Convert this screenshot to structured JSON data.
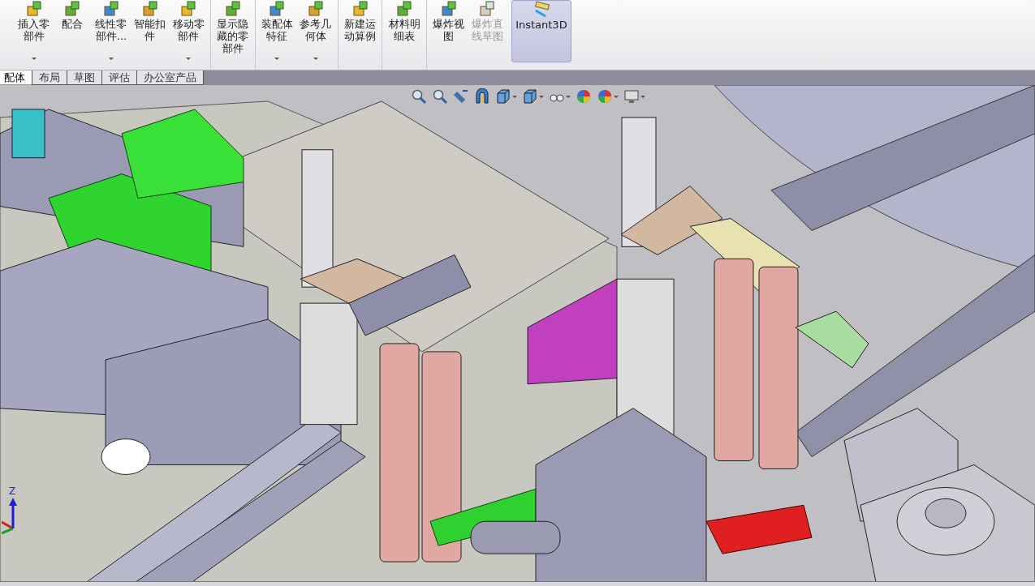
{
  "toolbar": {
    "items": [
      {
        "label": "插入零部件",
        "kind": "command",
        "dropdown": true,
        "disabled": false,
        "active": false,
        "group_start": false
      },
      {
        "label": "配合",
        "kind": "command",
        "dropdown": false,
        "disabled": false,
        "active": false,
        "group_start": false
      },
      {
        "label": "线性零部件...",
        "kind": "command",
        "dropdown": true,
        "disabled": false,
        "active": false,
        "group_start": false
      },
      {
        "label": "智能扣件",
        "kind": "command",
        "dropdown": false,
        "disabled": false,
        "active": false,
        "group_start": false
      },
      {
        "label": "移动零部件",
        "kind": "command",
        "dropdown": true,
        "disabled": false,
        "active": false,
        "group_start": false
      },
      {
        "label": "显示隐藏的零部件",
        "kind": "command",
        "dropdown": false,
        "disabled": false,
        "active": false,
        "group_start": true
      },
      {
        "label": "装配体特征",
        "kind": "command",
        "dropdown": true,
        "disabled": false,
        "active": false,
        "group_start": true
      },
      {
        "label": "参考几何体",
        "kind": "command",
        "dropdown": true,
        "disabled": false,
        "active": false,
        "group_start": false
      },
      {
        "label": "新建运动算例",
        "kind": "command",
        "dropdown": false,
        "disabled": false,
        "active": false,
        "group_start": true
      },
      {
        "label": "材料明细表",
        "kind": "command",
        "dropdown": false,
        "disabled": false,
        "active": false,
        "group_start": true
      },
      {
        "label": "爆炸视图",
        "kind": "command",
        "dropdown": false,
        "disabled": false,
        "active": false,
        "group_start": true
      },
      {
        "label": "爆炸直线草图",
        "kind": "command",
        "dropdown": false,
        "disabled": true,
        "active": false,
        "group_start": false
      },
      {
        "label": "Instant3D",
        "kind": "toggle",
        "dropdown": false,
        "disabled": false,
        "active": true,
        "group_start": true
      }
    ]
  },
  "tabs": [
    {
      "label": "配体",
      "selected": true
    },
    {
      "label": "布局",
      "selected": false
    },
    {
      "label": "草图",
      "selected": false
    },
    {
      "label": "评估",
      "selected": false
    },
    {
      "label": "办公室产品",
      "selected": false
    }
  ],
  "view_toolbar": [
    {
      "kind": "zoom-fit",
      "dropdown": false
    },
    {
      "kind": "zoom-area",
      "dropdown": false
    },
    {
      "kind": "previous",
      "dropdown": false
    },
    {
      "kind": "section",
      "dropdown": false
    },
    {
      "kind": "orientation",
      "dropdown": true
    },
    {
      "kind": "display",
      "dropdown": true
    },
    {
      "kind": "hide",
      "dropdown": true
    },
    {
      "kind": "appearance",
      "dropdown": false
    },
    {
      "kind": "scene",
      "dropdown": true
    },
    {
      "kind": "settings",
      "dropdown": true
    }
  ],
  "triad": {
    "axis_label": "Z"
  }
}
